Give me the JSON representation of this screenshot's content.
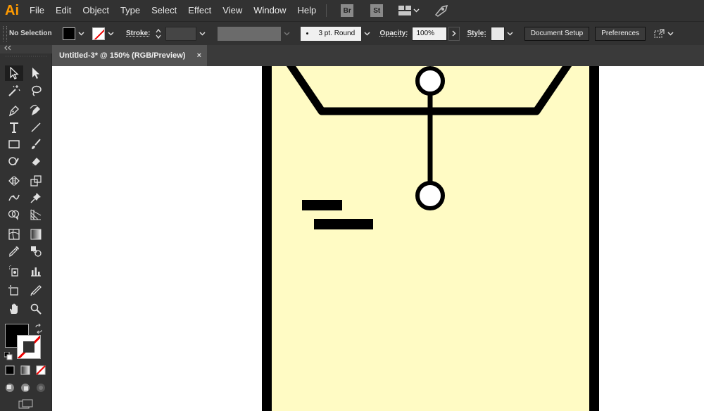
{
  "app": {
    "logo": "Ai"
  },
  "menu": [
    "File",
    "Edit",
    "Object",
    "Type",
    "Select",
    "Effect",
    "View",
    "Window",
    "Help"
  ],
  "menu_badges": {
    "bridge": "Br",
    "stock": "St"
  },
  "control": {
    "selection": "No Selection",
    "stroke_label": "Stroke:",
    "brush": "3 pt. Round",
    "opacity_label": "Opacity:",
    "opacity_value": "100%",
    "style_label": "Style:",
    "document_setup": "Document Setup",
    "preferences": "Preferences"
  },
  "document": {
    "tab_title": "Untitled-3* @ 150% (RGB/Preview)",
    "close_glyph": "×"
  },
  "colors": {
    "fill": "#000000",
    "artwork_fill": "#fffbc4",
    "artwork_stroke": "#000000",
    "app_accent": "#ff9a00"
  }
}
